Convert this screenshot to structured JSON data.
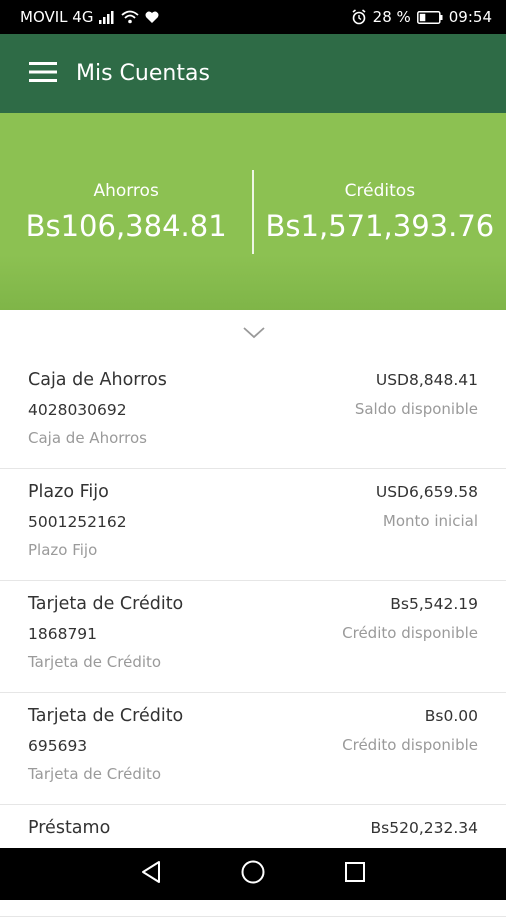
{
  "status_bar": {
    "carrier": "MOVIL 4G",
    "battery": "28 %",
    "time": "09:54",
    "icons": [
      "signal-icon",
      "wifi-icon",
      "heart-icon",
      "alarm-icon",
      "battery-icon"
    ]
  },
  "app_bar": {
    "title": "Mis Cuentas",
    "menu_icon": "menu-icon"
  },
  "summary": {
    "savings_label": "Ahorros",
    "savings_amount": "Bs106,384.81",
    "credits_label": "Créditos",
    "credits_amount": "Bs1,571,393.76"
  },
  "accounts": [
    {
      "name": "Caja de Ahorros",
      "number": "4028030692",
      "type": "Caja de Ahorros",
      "amount": "USD8,848.41",
      "caption": "Saldo disponible"
    },
    {
      "name": "Plazo Fijo",
      "number": "5001252162",
      "type": "Plazo Fijo",
      "amount": "USD6,659.58",
      "caption": "Monto inicial"
    },
    {
      "name": "Tarjeta de Crédito",
      "number": "1868791",
      "type": "Tarjeta de Crédito",
      "amount": "Bs5,542.19",
      "caption": "Crédito disponible"
    },
    {
      "name": "Tarjeta de Crédito",
      "number": "695693",
      "type": "Tarjeta de Crédito",
      "amount": "Bs0.00",
      "caption": "Crédito disponible"
    },
    {
      "name": "Préstamo",
      "number": "",
      "type": "",
      "amount": "Bs520,232.34",
      "caption": ""
    }
  ],
  "colors": {
    "app_bar": "#2e6b46",
    "summary_bg": "#8cc152",
    "text_primary": "#333333",
    "text_secondary": "#9a9a9a"
  }
}
